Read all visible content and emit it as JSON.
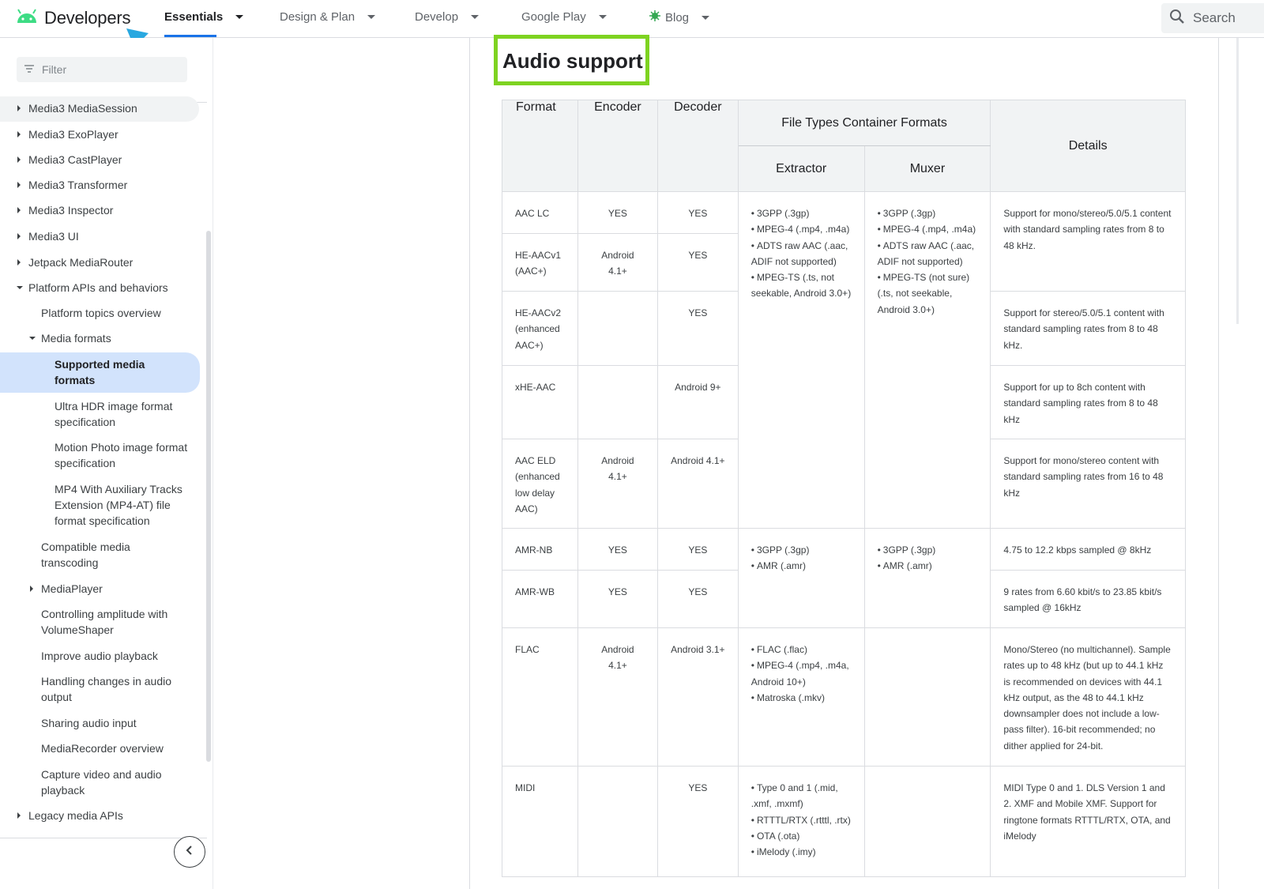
{
  "header": {
    "brand": "Developers",
    "nav": [
      {
        "label": "Essentials",
        "active": true
      },
      {
        "label": "Design & Plan"
      },
      {
        "label": "Develop"
      },
      {
        "label": "Google Play"
      },
      {
        "label": "Blog"
      }
    ],
    "search_placeholder": "Search"
  },
  "sidebar": {
    "filter_placeholder": "Filter",
    "items": [
      {
        "label": "Media3 MediaSession"
      },
      {
        "label": "Media3 ExoPlayer"
      },
      {
        "label": "Media3 CastPlayer"
      },
      {
        "label": "Media3 Transformer"
      },
      {
        "label": "Media3 Inspector"
      },
      {
        "label": "Media3 UI"
      },
      {
        "label": "Jetpack MediaRouter"
      },
      {
        "label": "Platform APIs and behaviors"
      },
      {
        "label": "Platform topics overview"
      },
      {
        "label": "Media formats"
      },
      {
        "label": "Supported media formats"
      },
      {
        "label": "Ultra HDR image format specification"
      },
      {
        "label": "Motion Photo image format specification"
      },
      {
        "label": "MP4 With Auxiliary Tracks Extension (MP4-AT) file format specification"
      },
      {
        "label": "Compatible media transcoding"
      },
      {
        "label": "MediaPlayer"
      },
      {
        "label": "Controlling amplitude with VolumeShaper"
      },
      {
        "label": "Improve audio playback"
      },
      {
        "label": "Handling changes in audio output"
      },
      {
        "label": "Sharing audio input"
      },
      {
        "label": "MediaRecorder overview"
      },
      {
        "label": "Capture video and audio playback"
      },
      {
        "label": "Legacy media APIs"
      }
    ]
  },
  "content": {
    "heading": "Audio support",
    "table": {
      "headers": {
        "format": "Format",
        "encoder": "Encoder",
        "decoder": "Decoder",
        "file_types": "File Types Container Formats",
        "extractor": "Extractor",
        "muxer": "Muxer",
        "details": "Details"
      },
      "rows": [
        {
          "format": "AAC LC",
          "encoder": "YES",
          "decoder": "YES"
        },
        {
          "format": "HE-AACv1 (AAC+)",
          "encoder": "Android 4.1+",
          "decoder": "YES"
        },
        {
          "format": "HE-AACv2 (enhanced AAC+)",
          "encoder": "",
          "decoder": "YES"
        },
        {
          "format": "xHE-AAC",
          "encoder": "",
          "decoder": "Android 9+"
        },
        {
          "format": "AAC ELD (enhanced low delay AAC)",
          "encoder": "Android 4.1+",
          "decoder": "Android 4.1+"
        },
        {
          "format": "AMR-NB",
          "encoder": "YES",
          "decoder": "YES"
        },
        {
          "format": "AMR-WB",
          "encoder": "YES",
          "decoder": "YES"
        },
        {
          "format": "FLAC",
          "encoder": "Android 4.1+",
          "decoder": "Android 3.1+"
        },
        {
          "format": "MIDI",
          "encoder": "",
          "decoder": "YES"
        }
      ],
      "aac_extractor": [
        "3GPP (.3gp)",
        "MPEG-4 (.mp4, .m4a)",
        "ADTS raw AAC (.aac, ADIF not supported)",
        "MPEG-TS (.ts, not seekable, Android 3.0+)"
      ],
      "aac_muxer": [
        "3GPP (.3gp)",
        "MPEG-4 (.mp4, .m4a)",
        "ADTS raw AAC (.aac, ADIF not supported)",
        "MPEG-TS (not sure) (.ts, not seekable, Android 3.0+)"
      ],
      "amr_extractor": [
        "3GPP (.3gp)",
        "AMR (.amr)"
      ],
      "amr_muxer": [
        "3GPP (.3gp)",
        "AMR (.amr)"
      ],
      "flac_extractor": [
        "FLAC (.flac)",
        "MPEG-4 (.mp4, .m4a, Android 10+)",
        "Matroska (.mkv)"
      ],
      "midi_extractor": [
        "Type 0 and 1 (.mid, .xmf, .mxmf)",
        "RTTTL/RTX (.rtttl, .rtx)",
        "OTA (.ota)",
        "iMelody (.imy)"
      ],
      "details": {
        "aac_lc_hev1": "Support for mono/stereo/5.0/5.1 content with standard sampling rates from 8 to 48 kHz.",
        "hev2": "Support for stereo/5.0/5.1 content with standard sampling rates from 8 to 48 kHz.",
        "xhe": "Support for up to 8ch content with standard sampling rates from 8 to 48 kHz",
        "eld": "Support for mono/stereo content with standard sampling rates from 16 to 48 kHz",
        "amr_nb": "4.75 to 12.2 kbps sampled @ 8kHz",
        "amr_wb": "9 rates from 6.60 kbit/s to 23.85 kbit/s sampled @ 16kHz",
        "flac": "Mono/Stereo (no multichannel). Sample rates up to 48 kHz (but up to 44.1 kHz is recommended on devices with 44.1 kHz output, as the 48 to 44.1 kHz downsampler does not include a low-pass filter). 16-bit recommended; no dither applied for 24-bit.",
        "midi": "MIDI Type 0 and 1. DLS Version 1 and 2. XMF and Mobile XMF. Support for ringtone formats RTTTL/RTX, OTA, and iMelody"
      }
    }
  },
  "colors": {
    "highlight_box": "#7ed321",
    "annotation_arrow": "#29a8e0",
    "android_green": "#3ddc84",
    "selected_bg": "#d2e3fc",
    "accent": "#1a73e8"
  }
}
